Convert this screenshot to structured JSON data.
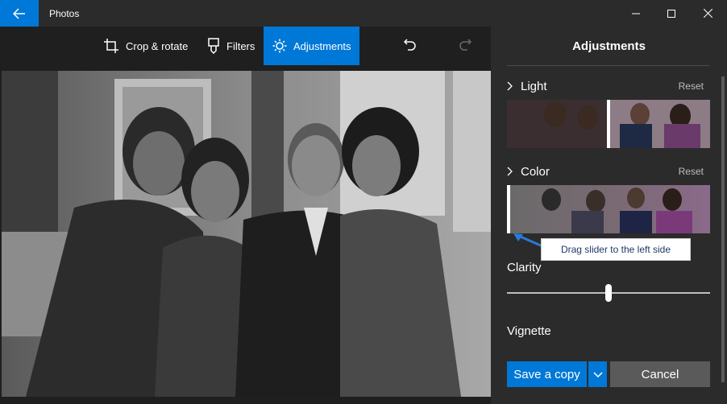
{
  "window": {
    "title": "Photos"
  },
  "toolbar": {
    "crop_label": "Crop & rotate",
    "filters_label": "Filters",
    "adjustments_label": "Adjustments"
  },
  "panel": {
    "title": "Adjustments",
    "light": {
      "label": "Light",
      "reset": "Reset"
    },
    "color": {
      "label": "Color",
      "reset": "Reset",
      "slider_value": 0
    },
    "tooltip": "Drag slider to the left side",
    "clarity": {
      "label": "Clarity",
      "value": 0.5
    },
    "vignette": {
      "label": "Vignette"
    },
    "save_label": "Save a copy",
    "cancel_label": "Cancel"
  },
  "colors": {
    "accent": "#0078d7",
    "panel": "#2b2b2b",
    "background": "#1f1f1f"
  },
  "icons": [
    "back-arrow-icon",
    "minimize-icon",
    "maximize-icon",
    "close-icon",
    "crop-icon",
    "filters-icon",
    "brightness-icon",
    "undo-icon",
    "redo-icon",
    "chevron-right-icon",
    "chevron-down-icon"
  ]
}
